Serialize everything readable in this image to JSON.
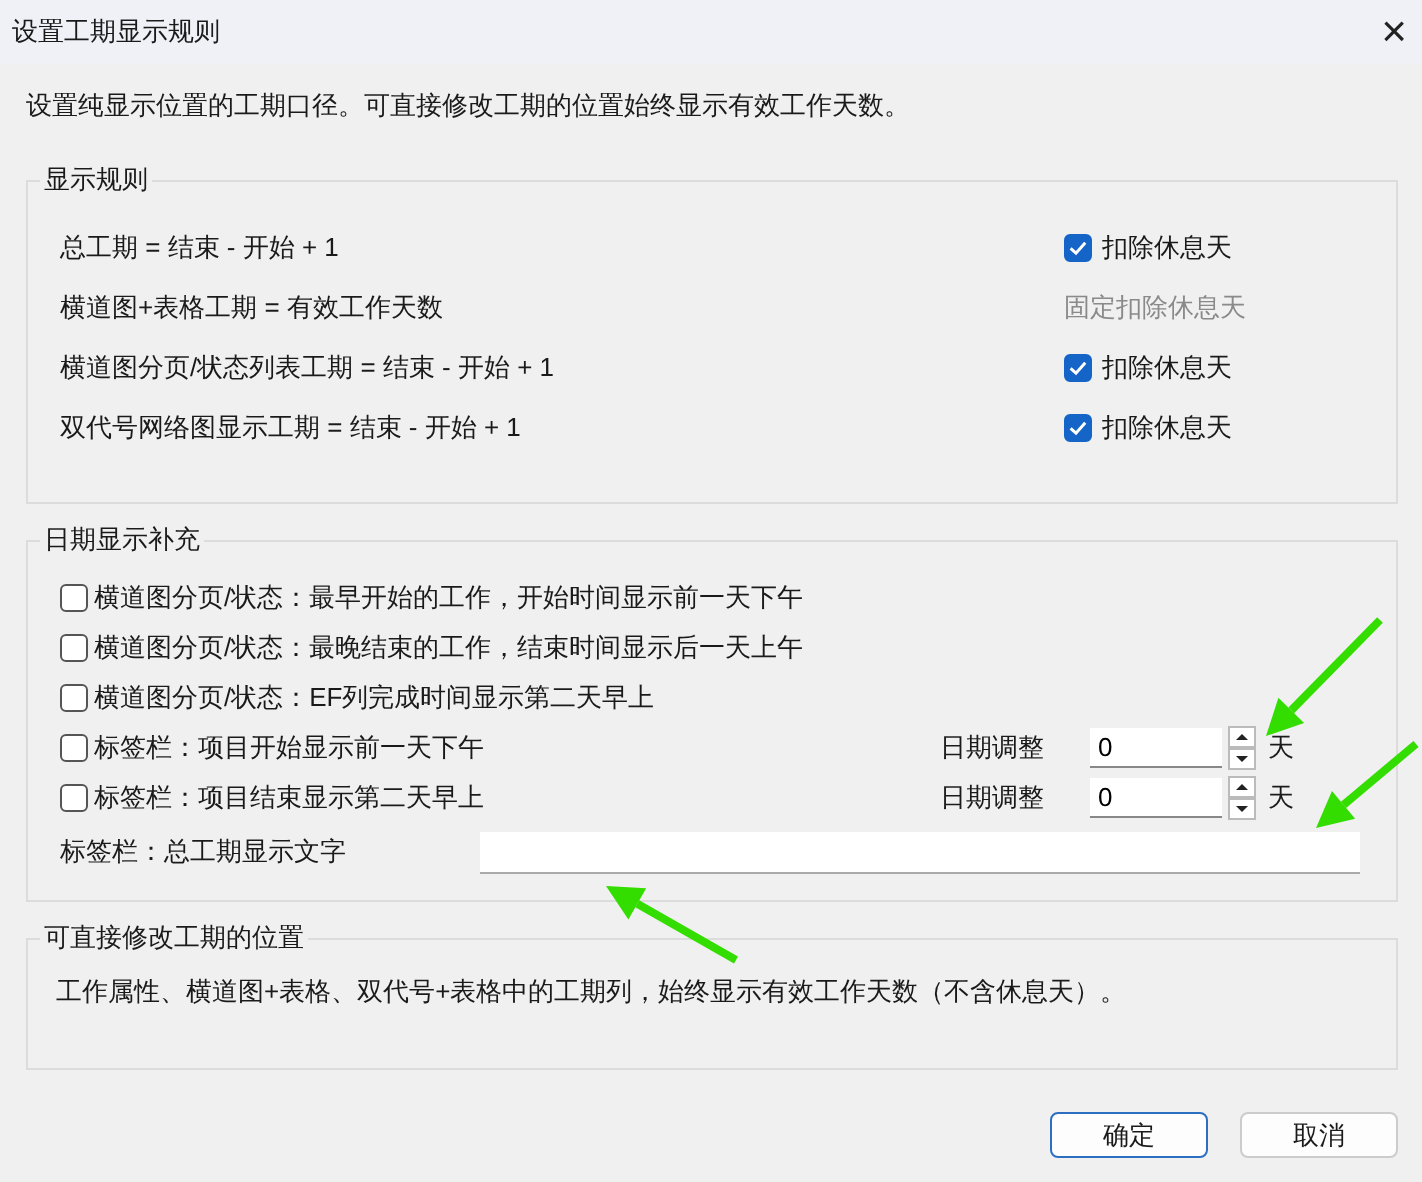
{
  "window": {
    "title": "设置工期显示规则",
    "close": "×"
  },
  "intro": "设置纯显示位置的工期口径。可直接修改工期的位置始终显示有效工作天数。",
  "display_rules": {
    "title": "显示规则",
    "rows": [
      {
        "label": "总工期 = 结束 - 开始 + 1",
        "option": {
          "kind": "checkbox",
          "label": "扣除休息天",
          "checked": true
        }
      },
      {
        "label": "横道图+表格工期 = 有效工作天数",
        "option": {
          "kind": "fixed",
          "label": "固定扣除休息天"
        }
      },
      {
        "label": "横道图分页/状态列表工期 = 结束 - 开始 + 1",
        "option": {
          "kind": "checkbox",
          "label": "扣除休息天",
          "checked": true
        }
      },
      {
        "label": "双代号网络图显示工期 = 结束 - 开始 + 1",
        "option": {
          "kind": "checkbox",
          "label": "扣除休息天",
          "checked": true
        }
      }
    ]
  },
  "date_supplement": {
    "title": "日期显示补充",
    "options": [
      {
        "label": "横道图分页/状态：最早开始的工作，开始时间显示前一天下午",
        "checked": false
      },
      {
        "label": "横道图分页/状态：最晚结束的工作，结束时间显示后一天上午",
        "checked": false
      },
      {
        "label": "横道图分页/状态：EF列完成时间显示第二天早上",
        "checked": false
      },
      {
        "label": "标签栏：项目开始显示前一天下午",
        "checked": false,
        "adjust": {
          "label": "日期调整",
          "value": "0",
          "unit": "天"
        }
      },
      {
        "label": "标签栏：项目结束显示第二天早上",
        "checked": false,
        "adjust": {
          "label": "日期调整",
          "value": "0",
          "unit": "天"
        }
      }
    ],
    "text_field": {
      "label": "标签栏：总工期显示文字"
    }
  },
  "editable": {
    "title": "可直接修改工期的位置",
    "text": "工作属性、横道图+表格、双代号+表格中的工期列，始终显示有效工作天数（不含休息天）。"
  },
  "buttons": [
    {
      "label": "确定",
      "default": true
    },
    {
      "label": "取消",
      "default": false
    }
  ]
}
